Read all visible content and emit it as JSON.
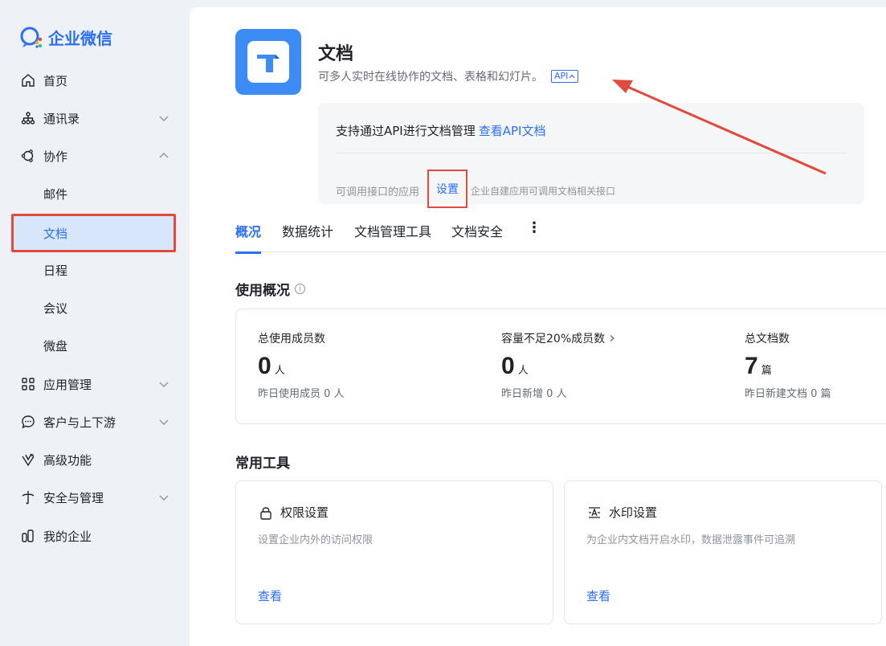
{
  "brand": {
    "name": "企业微信",
    "accent": "#2a6ff5"
  },
  "sidebar": {
    "items": [
      {
        "label": "首页",
        "icon": "home-icon",
        "expandable": false
      },
      {
        "label": "通讯录",
        "icon": "org-chart-icon",
        "expandable": true,
        "expanded": false
      },
      {
        "label": "协作",
        "icon": "collaboration-icon",
        "expandable": true,
        "expanded": true
      },
      {
        "label": "邮件",
        "sub": true
      },
      {
        "label": "文档",
        "sub": true,
        "active": true
      },
      {
        "label": "日程",
        "sub": true
      },
      {
        "label": "会议",
        "sub": true
      },
      {
        "label": "微盘",
        "sub": true
      },
      {
        "label": "应用管理",
        "icon": "grid-apps-icon",
        "expandable": true,
        "expanded": false
      },
      {
        "label": "客户与上下游",
        "icon": "chat-bubble-icon",
        "expandable": true,
        "expanded": false
      },
      {
        "label": "高级功能",
        "icon": "diamond-icon",
        "expandable": false
      },
      {
        "label": "安全与管理",
        "icon": "shield-icon",
        "expandable": true,
        "expanded": false
      },
      {
        "label": "我的企业",
        "icon": "building-icon",
        "expandable": false
      }
    ]
  },
  "app": {
    "title": "文档",
    "description": "可多人实时在线协作的文档、表格和幻灯片。",
    "api_chip": "API",
    "icon": "docs-app-icon"
  },
  "api_box": {
    "text": "支持通过API进行文档管理",
    "link": "查看API文档",
    "label": "可调用接口的应用",
    "settings": "设置",
    "hint": "企业自建应用可调用文档相关接口"
  },
  "tabs": [
    {
      "label": "概况",
      "active": true
    },
    {
      "label": "数据统计"
    },
    {
      "label": "文档管理工具"
    },
    {
      "label": "文档安全"
    }
  ],
  "overview": {
    "title": "使用概况",
    "stats": [
      {
        "label": "总使用成员数",
        "value": "0",
        "unit": "人",
        "sub": "昨日使用成员 0 人",
        "has_arrow": false
      },
      {
        "label": "容量不足20%成员数",
        "value": "0",
        "unit": "人",
        "sub": "昨日新增 0 人",
        "has_arrow": true
      },
      {
        "label": "总文档数",
        "value": "7",
        "unit": "篇",
        "sub": "昨日新建文档 0 篇",
        "has_arrow": false
      }
    ]
  },
  "tools": {
    "title": "常用工具",
    "items": [
      {
        "title": "权限设置",
        "icon": "lock-icon",
        "desc": "设置企业内外的访问权限",
        "link": "查看"
      },
      {
        "title": "水印设置",
        "icon": "watermark-icon",
        "desc": "为企业内文档开启水印，数据泄露事件可追溯",
        "link": "查看"
      }
    ]
  },
  "annotation": {
    "color": "#e04b3e"
  }
}
